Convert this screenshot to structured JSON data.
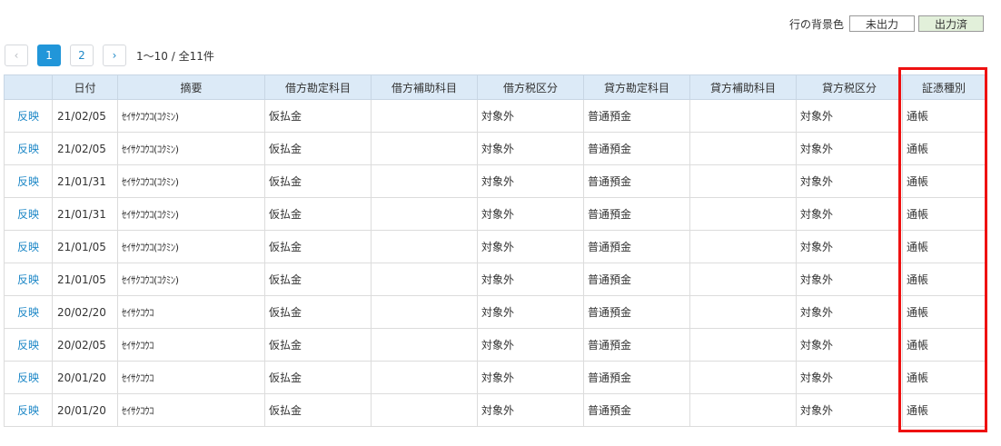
{
  "legend": {
    "label": "行の背景色",
    "unoutput": "未出力",
    "output": "出力済"
  },
  "pager": {
    "prev_icon": "chevron-left-icon",
    "pages": [
      "1",
      "2"
    ],
    "active_page": "1",
    "next_icon": "chevron-right-icon",
    "prev_glyph": "‹",
    "next_glyph": "›",
    "info": "1〜10 / 全11件"
  },
  "table": {
    "headers": [
      "",
      "日付",
      "摘要",
      "借方勘定科目",
      "借方補助科目",
      "借方税区分",
      "貸方勘定科目",
      "貸方補助科目",
      "貸方税区分",
      "証憑種別"
    ],
    "rows": [
      {
        "action": "反映",
        "date": "21/02/05",
        "summary": "ｾｲｻｸｺｳｺ(ｺｸﾐﾝ)",
        "debit_account": "仮払金",
        "debit_sub": "",
        "debit_tax": "対象外",
        "credit_account": "普通預金",
        "credit_sub": "",
        "credit_tax": "対象外",
        "voucher": "通帳"
      },
      {
        "action": "反映",
        "date": "21/02/05",
        "summary": "ｾｲｻｸｺｳｺ(ｺｸﾐﾝ)",
        "debit_account": "仮払金",
        "debit_sub": "",
        "debit_tax": "対象外",
        "credit_account": "普通預金",
        "credit_sub": "",
        "credit_tax": "対象外",
        "voucher": "通帳"
      },
      {
        "action": "反映",
        "date": "21/01/31",
        "summary": "ｾｲｻｸｺｳｺ(ｺｸﾐﾝ)",
        "debit_account": "仮払金",
        "debit_sub": "",
        "debit_tax": "対象外",
        "credit_account": "普通預金",
        "credit_sub": "",
        "credit_tax": "対象外",
        "voucher": "通帳"
      },
      {
        "action": "反映",
        "date": "21/01/31",
        "summary": "ｾｲｻｸｺｳｺ(ｺｸﾐﾝ)",
        "debit_account": "仮払金",
        "debit_sub": "",
        "debit_tax": "対象外",
        "credit_account": "普通預金",
        "credit_sub": "",
        "credit_tax": "対象外",
        "voucher": "通帳"
      },
      {
        "action": "反映",
        "date": "21/01/05",
        "summary": "ｾｲｻｸｺｳｺ(ｺｸﾐﾝ)",
        "debit_account": "仮払金",
        "debit_sub": "",
        "debit_tax": "対象外",
        "credit_account": "普通預金",
        "credit_sub": "",
        "credit_tax": "対象外",
        "voucher": "通帳"
      },
      {
        "action": "反映",
        "date": "21/01/05",
        "summary": "ｾｲｻｸｺｳｺ(ｺｸﾐﾝ)",
        "debit_account": "仮払金",
        "debit_sub": "",
        "debit_tax": "対象外",
        "credit_account": "普通預金",
        "credit_sub": "",
        "credit_tax": "対象外",
        "voucher": "通帳"
      },
      {
        "action": "反映",
        "date": "20/02/20",
        "summary": "ｾｲｻｸｺｳｺ",
        "debit_account": "仮払金",
        "debit_sub": "",
        "debit_tax": "対象外",
        "credit_account": "普通預金",
        "credit_sub": "",
        "credit_tax": "対象外",
        "voucher": "通帳"
      },
      {
        "action": "反映",
        "date": "20/02/05",
        "summary": "ｾｲｻｸｺｳｺ",
        "debit_account": "仮払金",
        "debit_sub": "",
        "debit_tax": "対象外",
        "credit_account": "普通預金",
        "credit_sub": "",
        "credit_tax": "対象外",
        "voucher": "通帳"
      },
      {
        "action": "反映",
        "date": "20/01/20",
        "summary": "ｾｲｻｸｺｳｺ",
        "debit_account": "仮払金",
        "debit_sub": "",
        "debit_tax": "対象外",
        "credit_account": "普通預金",
        "credit_sub": "",
        "credit_tax": "対象外",
        "voucher": "通帳"
      },
      {
        "action": "反映",
        "date": "20/01/20",
        "summary": "ｾｲｻｸｺｳｺ",
        "debit_account": "仮払金",
        "debit_sub": "",
        "debit_tax": "対象外",
        "credit_account": "普通預金",
        "credit_sub": "",
        "credit_tax": "対象外",
        "voucher": "通帳"
      }
    ]
  },
  "colors": {
    "header_bg": "#dceaf7",
    "link": "#1e88c7",
    "active_page": "#2196d9",
    "output_bg": "#e2f0da",
    "highlight": "#ee1111"
  }
}
